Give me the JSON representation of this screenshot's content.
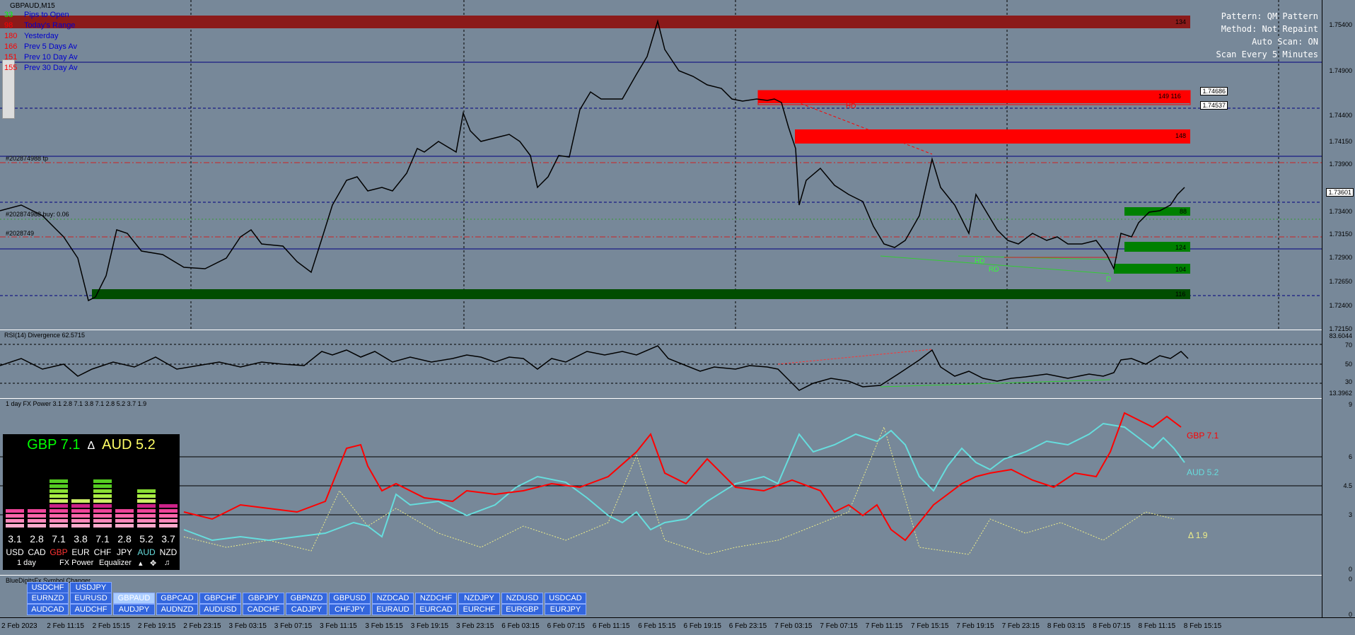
{
  "chart_title": "GBPAUD,M15",
  "info_lines": [
    {
      "num": "33",
      "text": "Pips to Open"
    },
    {
      "num": "98",
      "text": "Today's Range"
    },
    {
      "num": "180",
      "text": "Yesterday"
    },
    {
      "num": "166",
      "text": "Prev 5 Days Av"
    },
    {
      "num": "151",
      "text": "Prev 10 Day Av"
    },
    {
      "num": "155",
      "text": "Prev 30 Day Av"
    }
  ],
  "scan_panel": [
    "Pattern: QM Pattern",
    "Method: Not Repaint",
    "Auto Scan: ON",
    "Scan Every 5 Minutes"
  ],
  "order_labels": {
    "tp": "#202874988 tp",
    "buy": "#202874988 buy: 0.06",
    "sl": "#2028749"
  },
  "zone_labels": {
    "top_red": "134",
    "mid_red1": "149 116",
    "mid_red2": "148",
    "green1": "88",
    "green2": "124",
    "green3": "104",
    "bottom_green": "116"
  },
  "pattern_labels": {
    "hd_top": "HD",
    "hd_bottom": "HD",
    "rd": "RD",
    "d": "D"
  },
  "price_axis": [
    "1.75400",
    "1.74900",
    "1.74400",
    "1.74150",
    "1.73900",
    "1.73400",
    "1.73150",
    "1.72900",
    "1.72650",
    "1.72400",
    "1.72150"
  ],
  "price_boxes": {
    "p1": "1.74686",
    "p2": "1.74537",
    "current": "1.73601"
  },
  "rsi": {
    "title": "RSI(14) Divergence 62.5715",
    "top": "83.6044",
    "l70": "70",
    "l50": "50",
    "l30": "30",
    "bottom": "13.3962"
  },
  "fx_power": {
    "title": "1 day FX Power 3.1 2.8 7.1 3.8 7.1 2.8 5.2 3.7 1.9",
    "axis": [
      "9",
      "6",
      "4.5",
      "3",
      "0"
    ],
    "labels": {
      "gbp": "GBP 7.1",
      "aud": "AUD 5.2",
      "delta": "Δ 1.9"
    }
  },
  "equalizer": {
    "head_left": "GBP 7.1",
    "head_sep": "Δ",
    "head_right": "AUD 5.2",
    "values": [
      "3.1",
      "2.8",
      "7.1",
      "3.8",
      "7.1",
      "2.8",
      "5.2",
      "3.7"
    ],
    "currencies": [
      "USD",
      "CAD",
      "GBP",
      "EUR",
      "CHF",
      "JPY",
      "AUD",
      "NZD"
    ],
    "footer": {
      "period": "1 day",
      "name": "FX Power",
      "mode": "Equalizer"
    }
  },
  "symbol_changer": {
    "title": "BlueDigitsFx Symbol Changer",
    "row1": [
      "USDCHF",
      "USDJPY"
    ],
    "row2": [
      "EURNZD",
      "EURUSD",
      "GBPAUD",
      "GBPCAD",
      "GBPCHF",
      "GBPJPY",
      "GBPNZD",
      "GBPUSD",
      "NZDCAD",
      "NZDCHF",
      "NZDJPY",
      "NZDUSD",
      "USDCAD"
    ],
    "row3": [
      "AUDCAD",
      "AUDCHF",
      "AUDJPY",
      "AUDNZD",
      "AUDUSD",
      "CADCHF",
      "CADJPY",
      "CHFJPY",
      "EURAUD",
      "EURCAD",
      "EURCHF",
      "EURGBP",
      "EURJPY"
    ],
    "active": "GBPAUD",
    "axis": [
      "0",
      "0"
    ]
  },
  "time_axis": [
    "2 Feb 2023",
    "2 Feb 11:15",
    "2 Feb 15:15",
    "2 Feb 19:15",
    "2 Feb 23:15",
    "3 Feb 03:15",
    "3 Feb 07:15",
    "3 Feb 11:15",
    "3 Feb 15:15",
    "3 Feb 19:15",
    "3 Feb 23:15",
    "6 Feb 03:15",
    "6 Feb 07:15",
    "6 Feb 11:15",
    "6 Feb 15:15",
    "6 Feb 19:15",
    "6 Feb 23:15",
    "7 Feb 03:15",
    "7 Feb 07:15",
    "7 Feb 11:15",
    "7 Feb 15:15",
    "7 Feb 19:15",
    "7 Feb 23:15",
    "8 Feb 03:15",
    "8 Feb 07:15",
    "8 Feb 11:15",
    "8 Feb 15:15"
  ],
  "colors": {
    "bg": "#778899",
    "bear_zone": "#ff0000",
    "bull_zone": "#008000",
    "gbp": "#ff0000",
    "aud": "#66dddd",
    "delta": "#eeee88"
  }
}
